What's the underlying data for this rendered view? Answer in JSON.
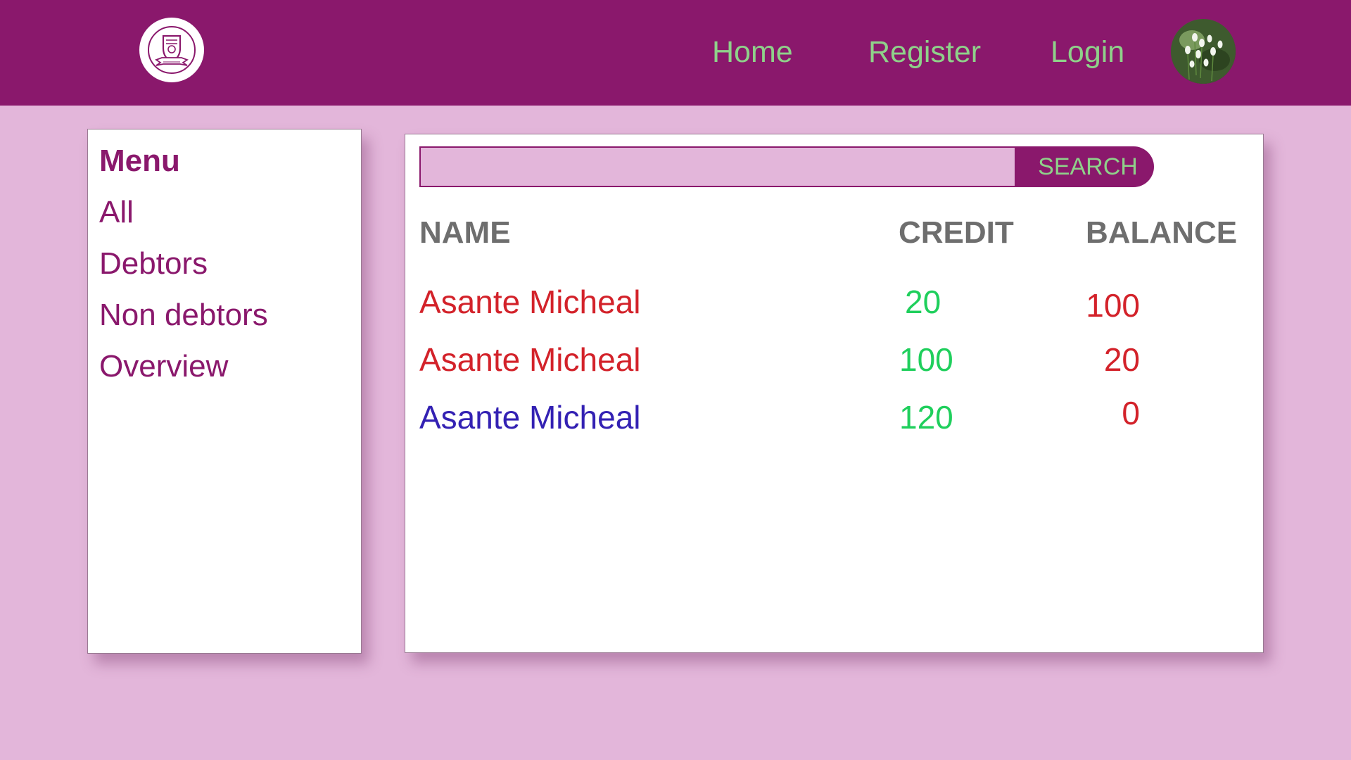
{
  "colors": {
    "header_bg": "#8a186c",
    "page_bg": "#e3b6da",
    "nav_text": "#8fd18a",
    "menu_text": "#8a186c",
    "header_text": "#6e6e6e",
    "debtor_red": "#d3222a",
    "settled_blue": "#3321b3",
    "credit_green": "#1fcf5c"
  },
  "header": {
    "logo_icon": "school-crest-icon",
    "nav": {
      "home": "Home",
      "register": "Register",
      "login": "Login"
    },
    "avatar_icon": "user-avatar-photo"
  },
  "sidebar": {
    "title": "Menu",
    "items": [
      {
        "label": "All"
      },
      {
        "label": "Debtors"
      },
      {
        "label": "Non debtors"
      },
      {
        "label": "Overview"
      }
    ]
  },
  "search": {
    "value": "",
    "placeholder": "",
    "button_label": "SEARCH"
  },
  "table": {
    "columns": {
      "name": "NAME",
      "credit": "CREDIT",
      "balance": "BALANCE"
    },
    "rows": [
      {
        "name": "Asante Micheal",
        "credit": "20",
        "balance": "100",
        "name_color": "#d3222a",
        "credit_color": "#1fcf5c",
        "balance_color": "#d3222a"
      },
      {
        "name": "Asante Micheal",
        "credit": "100",
        "balance": "20",
        "name_color": "#d3222a",
        "credit_color": "#1fcf5c",
        "balance_color": "#d3222a"
      },
      {
        "name": "Asante Micheal",
        "credit": "120",
        "balance": "0",
        "name_color": "#3321b3",
        "credit_color": "#1fcf5c",
        "balance_color": "#d3222a"
      }
    ]
  }
}
